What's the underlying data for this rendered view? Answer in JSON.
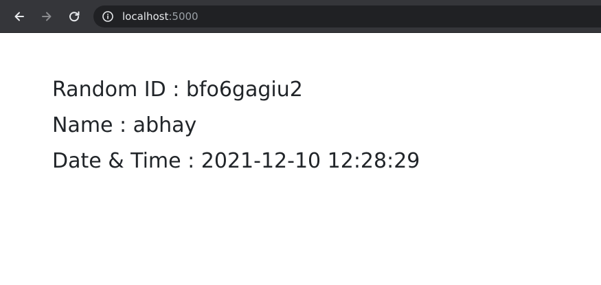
{
  "browser": {
    "url_host": "localhost",
    "url_port": ":5000",
    "icons": {
      "back": "arrow-left-icon",
      "forward": "arrow-right-icon",
      "reload": "reload-icon",
      "info": "info-icon"
    },
    "colors": {
      "toolbar_bg": "#35363a",
      "omnibox_bg": "#202124",
      "url_text": "#e8eaed",
      "url_port_text": "#9aa0a6"
    }
  },
  "page": {
    "lines": [
      {
        "text": "Random ID : bfo6gagiu2"
      },
      {
        "text": "Name : abhay"
      },
      {
        "text": "Date & Time : 2021-12-10 12:28:29"
      }
    ],
    "colors": {
      "background": "#ffffff",
      "text": "#212529"
    }
  }
}
